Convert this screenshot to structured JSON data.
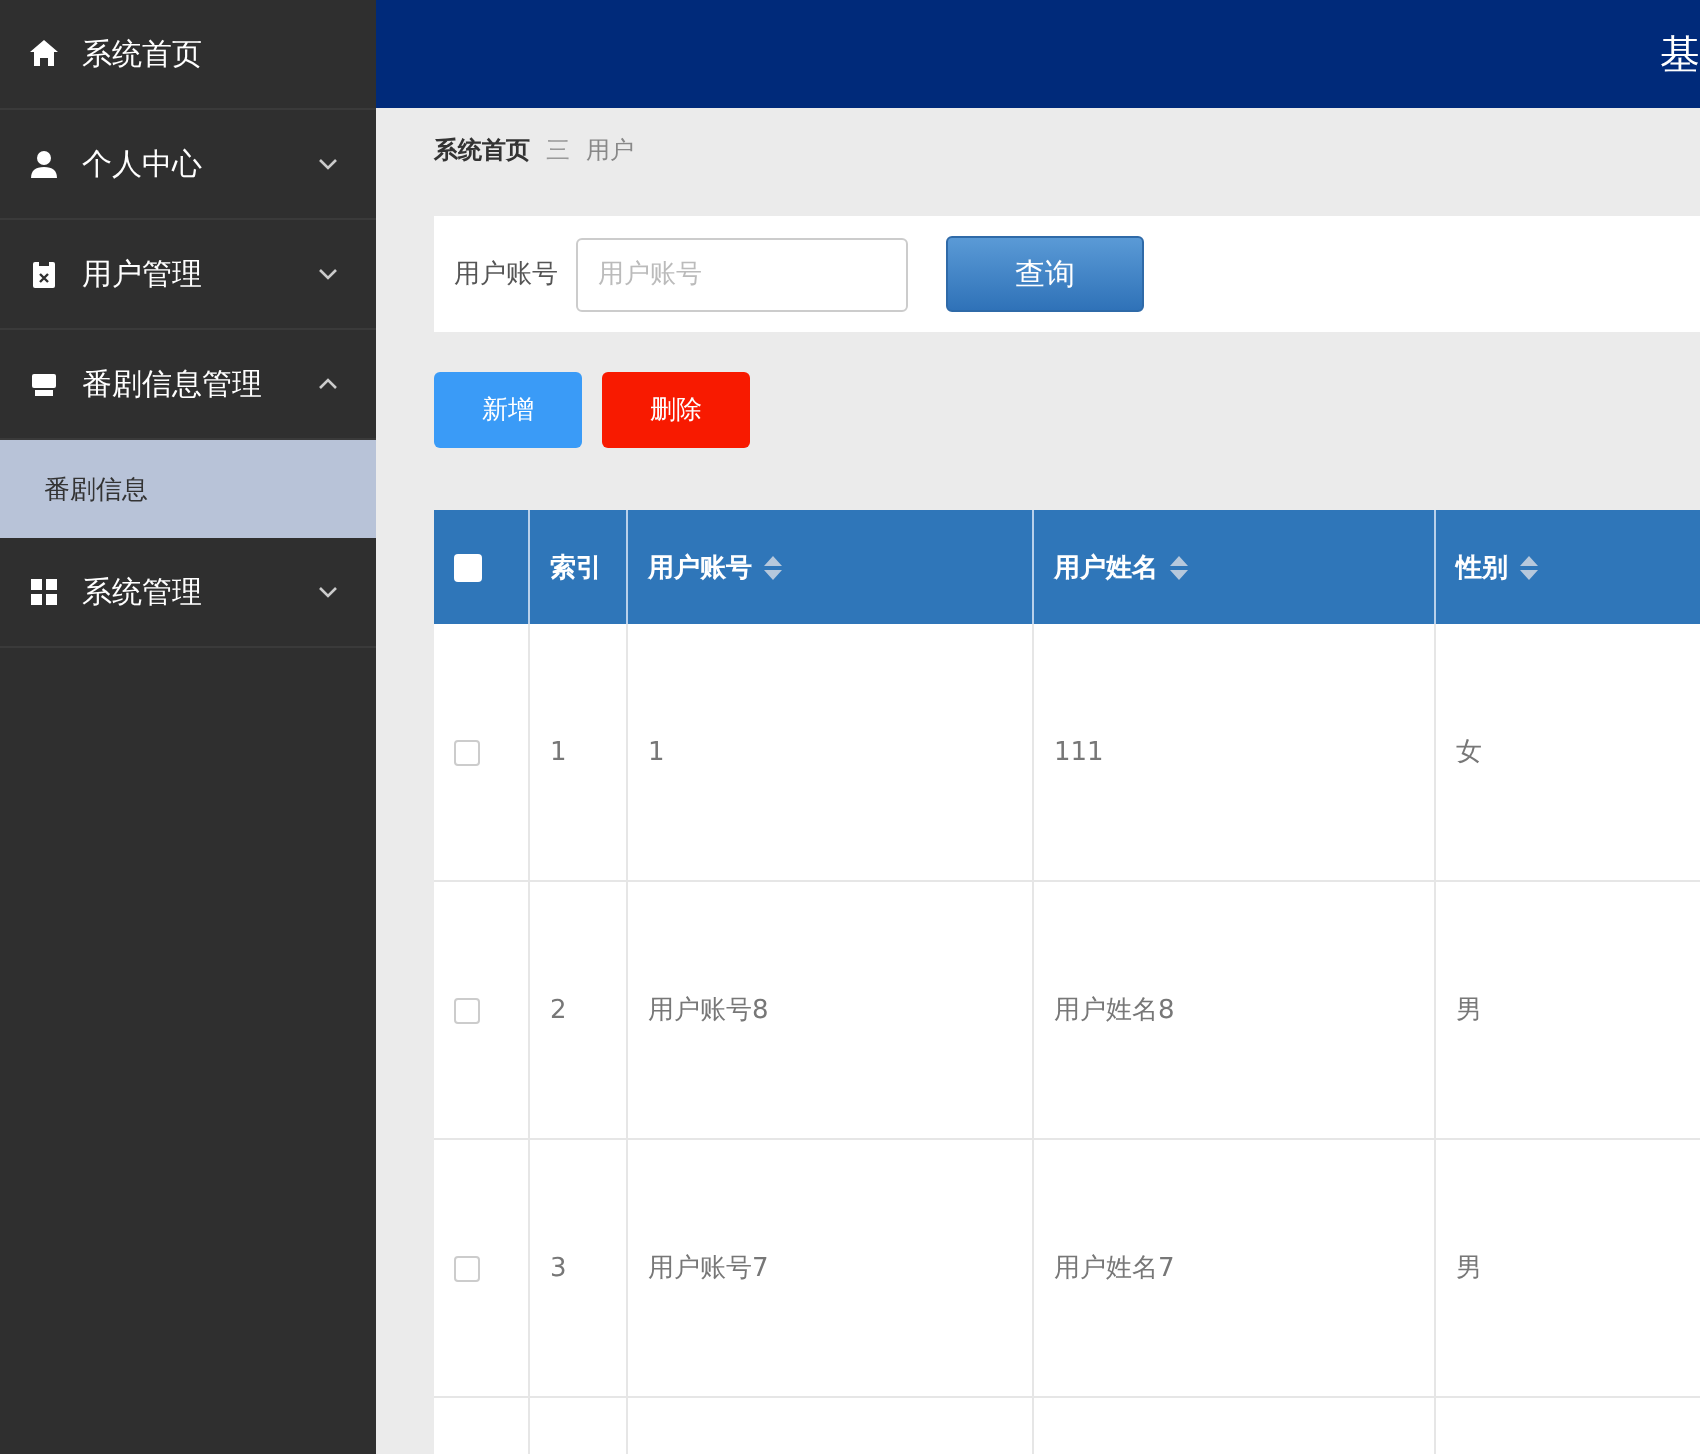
{
  "header": {
    "title": "基"
  },
  "sidebar": {
    "items": [
      {
        "label": "系统首页",
        "kind": "link"
      },
      {
        "label": "个人中心",
        "kind": "menu",
        "expanded": false
      },
      {
        "label": "用户管理",
        "kind": "menu",
        "expanded": false
      },
      {
        "label": "番剧信息管理",
        "kind": "menu",
        "expanded": true,
        "children": [
          {
            "label": "番剧信息",
            "selected": true
          }
        ]
      },
      {
        "label": "系统管理",
        "kind": "menu",
        "expanded": false
      }
    ]
  },
  "breadcrumb": {
    "items": [
      "系统首页",
      "用户"
    ],
    "separator": "三"
  },
  "search": {
    "label": "用户账号",
    "placeholder": "用户账号",
    "button": "查询"
  },
  "actions": [
    {
      "label": "新增",
      "kind": "add"
    },
    {
      "label": "删除",
      "kind": "delete"
    }
  ],
  "table": {
    "select_all": {
      "checked": false
    },
    "columns": [
      {
        "label": "索引",
        "sortable": false
      },
      {
        "label": "用户账号",
        "sortable": true
      },
      {
        "label": "用户姓名",
        "sortable": true
      },
      {
        "label": "性别",
        "sortable": true
      }
    ],
    "rows": [
      {
        "checked": false,
        "cells": [
          "1",
          "1",
          "111",
          "女"
        ]
      },
      {
        "checked": false,
        "cells": [
          "2",
          "用户账号8",
          "用户姓名8",
          "男"
        ]
      },
      {
        "checked": false,
        "cells": [
          "3",
          "用户账号7",
          "用户姓名7",
          "男"
        ]
      }
    ]
  }
}
